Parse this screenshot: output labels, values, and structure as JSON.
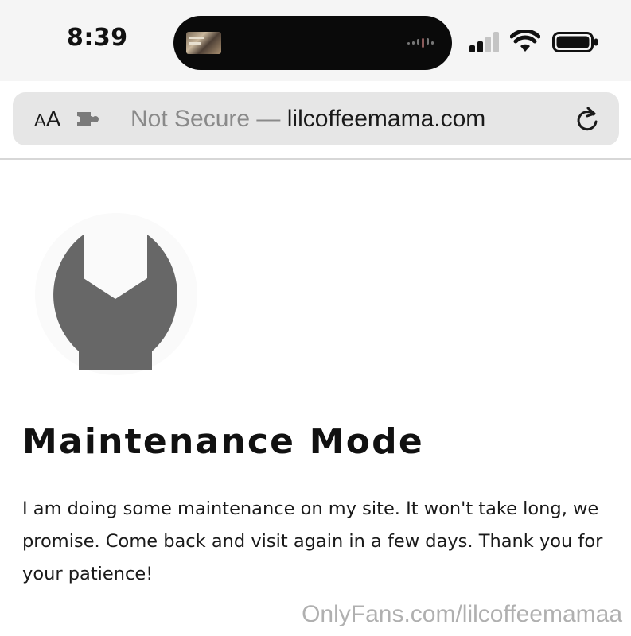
{
  "status_bar": {
    "time": "8:39"
  },
  "browser": {
    "aa_small": "A",
    "aa_large": "A",
    "url_not_secure": "Not Secure — ",
    "url_domain": "lilcoffeemama.com"
  },
  "page": {
    "title": "Maintenance Mode",
    "message": "I am doing some maintenance on my site. It won't take long, we promise. Come back and visit again in a few days. Thank you for your patience!",
    "icon": "wrench-icon"
  },
  "watermark": "OnlyFans.com/lilcoffeemamaa",
  "colors": {
    "status_bar_bg": "#f5f5f5",
    "url_bar_bg": "#e6e6e6",
    "wrench": "#676767",
    "text": "#111111"
  }
}
